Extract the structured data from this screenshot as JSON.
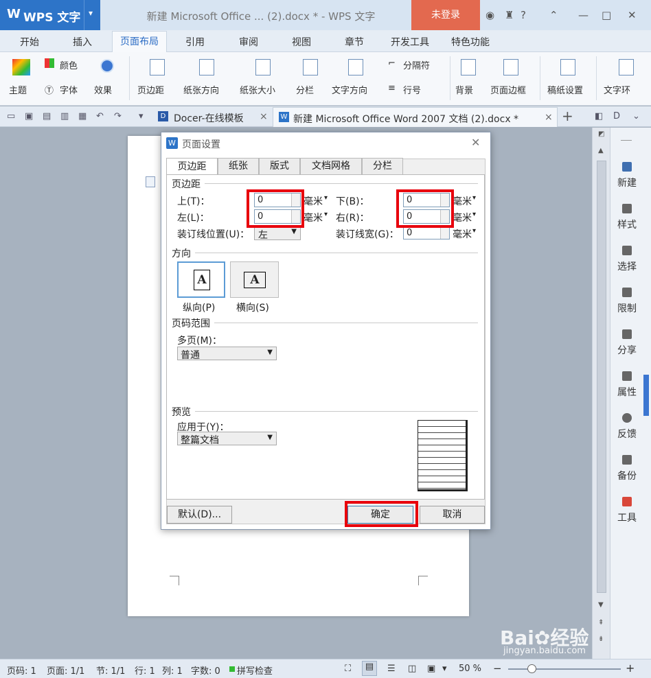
{
  "titlebar": {
    "app_logo": "W",
    "app_name": "WPS 文字",
    "doc_title": "新建 Microsoft Office ... (2).docx * - WPS 文字",
    "login": "未登录"
  },
  "menu": [
    "开始",
    "插入",
    "页面布局",
    "引用",
    "审阅",
    "视图",
    "章节",
    "开发工具",
    "特色功能"
  ],
  "ribbon": {
    "theme": "主题",
    "colors": "颜色",
    "font": "字体",
    "effects": "效果",
    "margins": "页边距",
    "orientation": "纸张方向",
    "size": "纸张大小",
    "columns": "分栏",
    "text_direction": "文字方向",
    "breaks": "分隔符",
    "line_numbers": "行号",
    "background": "背景",
    "page_border": "页面边框",
    "manuscript": "稿纸设置",
    "wrap": "文字环"
  },
  "tabs": {
    "tab1": "Docer-在线模板",
    "tab2": "新建 Microsoft Office Word 2007 文档 (2).docx *",
    "close": "×",
    "add": "+"
  },
  "sidebar": [
    "新建",
    "样式",
    "选择",
    "限制",
    "分享",
    "属性",
    "反馈",
    "备份",
    "工具"
  ],
  "status": {
    "page": "页码: 1",
    "pages": "页面: 1/1",
    "section": "节: 1/1",
    "row": "行: 1",
    "col": "列: 1",
    "words": "字数: 0",
    "spell": "拼写检查",
    "zoom": "50 %",
    "minus": "−",
    "plus": "+"
  },
  "dialog": {
    "logo": "W",
    "title": "页面设置",
    "close": "✕",
    "tabs": [
      "页边距",
      "纸张",
      "版式",
      "文档网格",
      "分栏"
    ],
    "margins_group": "页边距",
    "top_label": "上(T)：",
    "top_value": "0",
    "bottom_label": "下(B)：",
    "bottom_value": "0",
    "left_label": "左(L)：",
    "left_value": "0",
    "right_label": "右(R)：",
    "right_value": "0",
    "gutter_pos_label": "装订线位置(U)：",
    "gutter_pos_value": "左",
    "gutter_width_label": "装订线宽(G)：",
    "gutter_width_value": "0",
    "unit": "毫米",
    "orientation_group": "方向",
    "portrait": "纵向(P)",
    "landscape": "横向(S)",
    "glyph": "A",
    "pages_group": "页码范围",
    "multi_pages_label": "多页(M)：",
    "multi_pages_value": "普通",
    "preview_group": "预览",
    "apply_to_label": "应用于(Y)：",
    "apply_to_value": "整篇文档",
    "default_btn": "默认(D)...",
    "ok_btn": "确定",
    "cancel_btn": "取消"
  },
  "watermark": {
    "brand": "Bai",
    "brand2": "经验",
    "url": "jingyan.baidu.com"
  },
  "colors": {
    "accent": "#2d74c8",
    "login": "#e3694f",
    "highlight": "#e8000c"
  }
}
